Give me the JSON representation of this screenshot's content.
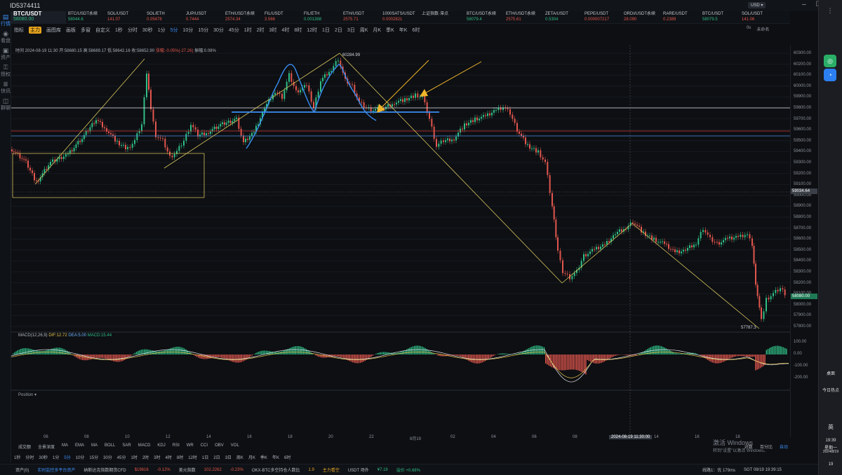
{
  "titlebar": {
    "account_id": "ID5374411"
  },
  "sidebar": {
    "items": [
      {
        "label": "行情",
        "icon": "chart-icon",
        "active": true
      },
      {
        "label": "看盘",
        "icon": "eye-icon",
        "active": false
      },
      {
        "label": "资产",
        "icon": "wallet-icon",
        "active": false
      },
      {
        "label": "授权",
        "icon": "key-icon",
        "active": false
      },
      {
        "label": "快讯",
        "icon": "news-icon",
        "active": false
      },
      {
        "label": "群聊",
        "icon": "chat-icon",
        "active": false
      }
    ]
  },
  "tickers": [
    {
      "name": "BTC/USDT",
      "price": "58080.00",
      "dir": "up",
      "main": true
    },
    {
      "name": "BTC/USDT永续",
      "price": "58044.6",
      "dir": "up"
    },
    {
      "name": "SOL/USDT",
      "price": "141.07",
      "dir": "dn"
    },
    {
      "name": "SOL/ETH",
      "price": "0.05478",
      "dir": "dn"
    },
    {
      "name": "JUP/USDT",
      "price": "0.7444",
      "dir": "dn"
    },
    {
      "name": "ETH/USDT永续",
      "price": "2574.34",
      "dir": "dn"
    },
    {
      "name": "FIL/USDT",
      "price": "3.566",
      "dir": "dn"
    },
    {
      "name": "FIL/ETH",
      "price": "0.001388",
      "dir": "up"
    },
    {
      "name": "ETH/USDT",
      "price": "2575.71",
      "dir": "dn"
    },
    {
      "name": "1000SATS/USDT",
      "price": "0.0002821",
      "dir": "dn"
    },
    {
      "name": "上证指数·滞点",
      "price": "",
      "dir": "dn",
      "wide": true
    },
    {
      "name": "BTC/USDT永续",
      "price": "58079.4",
      "dir": "up"
    },
    {
      "name": "ETH/USDT永续",
      "price": "2575.61",
      "dir": "dn"
    },
    {
      "name": "ZETA/USDT",
      "price": "0.5304",
      "dir": "up"
    },
    {
      "name": "PEPE/USDT",
      "price": "0.000007217",
      "dir": "dn"
    },
    {
      "name": "ORDI/USDT永续",
      "price": "28.090",
      "dir": "dn"
    },
    {
      "name": "RARE/USDT",
      "price": "0.2389",
      "dir": "dn"
    },
    {
      "name": "BTC/USDT",
      "price": "58079.5",
      "dir": "up"
    },
    {
      "name": "SOL/USDT",
      "price": "141.06",
      "dir": "dn"
    }
  ],
  "currency_select": "USD ▾",
  "toolbar": {
    "items": [
      "指标",
      "主力",
      "画图库",
      "画板",
      "多窗",
      "自定义",
      "1秒",
      "分时",
      "30秒",
      "1分",
      "5分",
      "10分",
      "15分",
      "30分",
      "45分",
      "1时",
      "2时",
      "3时",
      "4时",
      "8时",
      "12时",
      "1日",
      "2日",
      "3日",
      "周K",
      "月K",
      "季K",
      "年K",
      "6时"
    ],
    "selected": "5分",
    "right": [
      "0s",
      "未命名"
    ]
  },
  "info_line": {
    "time": "时间 2024-08-19 11:30",
    "open": "开:58680.15",
    "high": "高:58689.17",
    "low": "低:58642.16",
    "close": "收:58652.90",
    "change": "涨幅:-0.05%(-27.26)",
    "amplitude": "振幅:0.08%"
  },
  "chart_annotations": {
    "peak_label": "60284.99",
    "low_label": "57787.3"
  },
  "price_axis": {
    "labels": [
      "60300.00",
      "60200.00",
      "60100.00",
      "60000.00",
      "59900.00",
      "59800.00",
      "59700.00",
      "59600.00",
      "59500.00",
      "59400.00",
      "59300.00",
      "59200.00",
      "59100.00",
      "59000.00",
      "58900.00",
      "58800.00",
      "58700.00",
      "58600.00",
      "58500.00",
      "58400.00",
      "58300.00",
      "58200.00",
      "58100.00",
      "58000.00",
      "57900.00",
      "57800.00"
    ],
    "crosshair_price": "59034.64",
    "last_price": "58080.00"
  },
  "macd": {
    "label": "MACD(12,26,9)",
    "dif": "DIF:12.72",
    "dea": "DEA:5.00",
    "macd": "MACD:15.44",
    "axis": [
      "100.00",
      "0.00",
      "-100.00",
      "-200.00"
    ]
  },
  "position_label": "Position ▾",
  "time_axis": {
    "labels": [
      "06",
      "08",
      "10",
      "12",
      "14",
      "16",
      "18",
      "20",
      "22",
      "8月19",
      "02",
      "04",
      "06",
      "08",
      "10",
      "14",
      "16",
      "18"
    ],
    "crosshair_time": "2024-08-19 11:30:00"
  },
  "bottom_tools": {
    "items": [
      "成交额",
      "全景深度",
      "MA",
      "EMA",
      "MA",
      "BOLL",
      "SAR",
      "MACD",
      "KDJ",
      "RSI",
      "WR",
      "CCI",
      "OBV",
      "VOL"
    ],
    "right": [
      "对数",
      "百分比",
      "自动"
    ]
  },
  "timeframe_row": [
    "1秒",
    "分时",
    "30秒",
    "1分",
    "5分",
    "10分",
    "15分",
    "30分",
    "45分",
    "1时",
    "2时",
    "3时",
    "4时",
    "8时",
    "12时",
    "1日",
    "2日",
    "3日",
    "周K",
    "月K",
    "季K",
    "年K",
    "6时"
  ],
  "timeframe_selected": "5分",
  "status_bar": {
    "assets": "资产(0)",
    "monitor": "实时监控多平台资产",
    "nasdaq_label": "纳斯达克指数期货CFD",
    "nasdaq_value": "$19616",
    "nasdaq_change": "-0.12%",
    "usd_index_label": "美元指数",
    "usd_index_value": "102.2262",
    "usd_index_change": "-0.23%",
    "okx_label": "OKX-BTC多空持仓人数比",
    "okx_value": "1.9",
    "okx_note": "主力看空",
    "usdt_label": "USDT 场外",
    "usdt_value": "¥7.19",
    "usdt_premium": "溢价 +0.68%",
    "line": "线路1：优 179ms",
    "clock": "SGT 08/19 19:39:15"
  },
  "watermark": {
    "line1": "激活 Windows",
    "line2": "转到\"设置\"以激活 Windows。"
  },
  "taskbar": {
    "weather": "今日热点",
    "ime": "英",
    "time": "19:39",
    "weekday": "星期一",
    "date": "2024/8/19",
    "notif": "19"
  },
  "colors": {
    "up": "#2fbd85",
    "down": "#e2564d",
    "accent": "#3d8ef7",
    "trendline": "#d8c45c",
    "annotation_blue": "#3a8ef5",
    "arrow": "#f0b52a"
  }
}
